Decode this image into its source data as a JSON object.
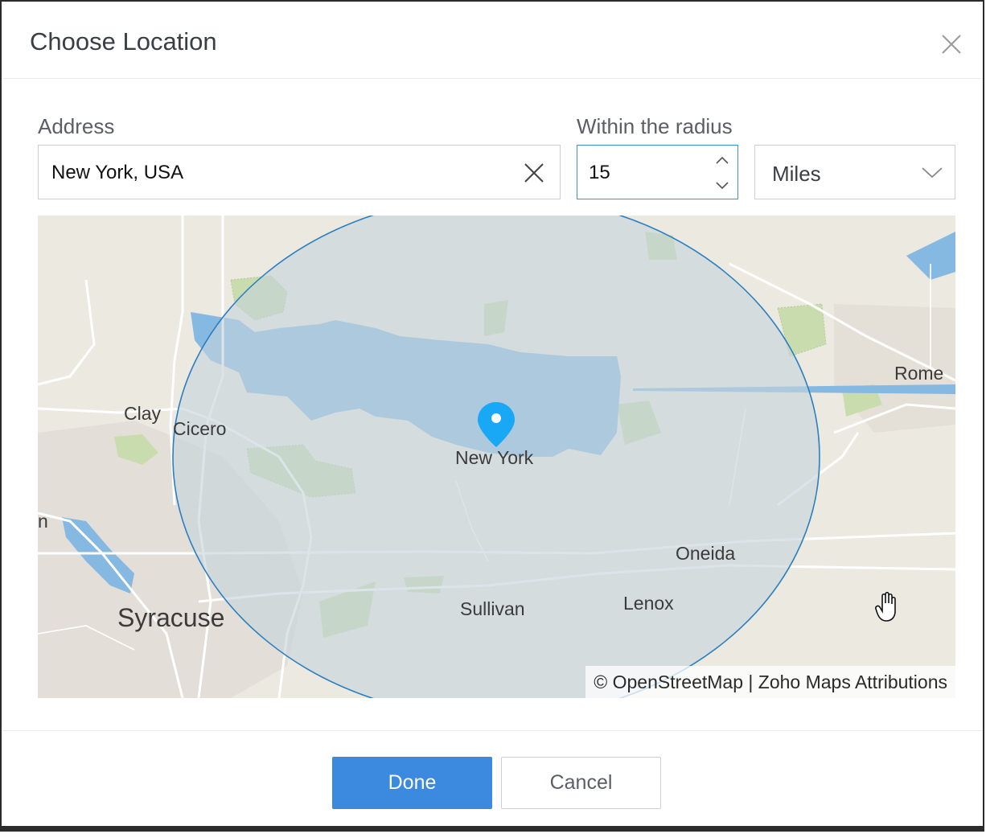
{
  "dialog": {
    "title": "Choose Location"
  },
  "form": {
    "address_label": "Address",
    "address_value": "New York, USA",
    "radius_label": "Within the radius",
    "radius_value": "15",
    "unit_value": "Miles"
  },
  "map": {
    "marker_label": "New York",
    "places": {
      "rome": "Rome",
      "clay": "Clay",
      "cicero": "Cicero",
      "oneida": "Oneida",
      "sullivan": "Sullivan",
      "lenox": "Lenox",
      "syracuse": "Syracuse",
      "partial_left": "n"
    },
    "attribution": {
      "prefix": "© ",
      "osm": "OpenStreetMap",
      "separator": " | ",
      "zoho": "Zoho Maps Attributions"
    },
    "colors": {
      "land": "#ece9e1",
      "water": "#85b9e1",
      "park": "#c9dcae",
      "radius_fill": "#c5d3dc",
      "radius_stroke": "#2a7fc1",
      "marker": "#19a8f5"
    }
  },
  "footer": {
    "done_label": "Done",
    "cancel_label": "Cancel"
  },
  "icons": {
    "close": "close-icon",
    "clear": "clear-icon",
    "spin_up": "chevron-up-icon",
    "spin_down": "chevron-down-icon",
    "dropdown": "chevron-down-icon",
    "marker": "map-pin-icon",
    "cursor": "hand-cursor-icon"
  },
  "accent_color": "#3b8ae0"
}
